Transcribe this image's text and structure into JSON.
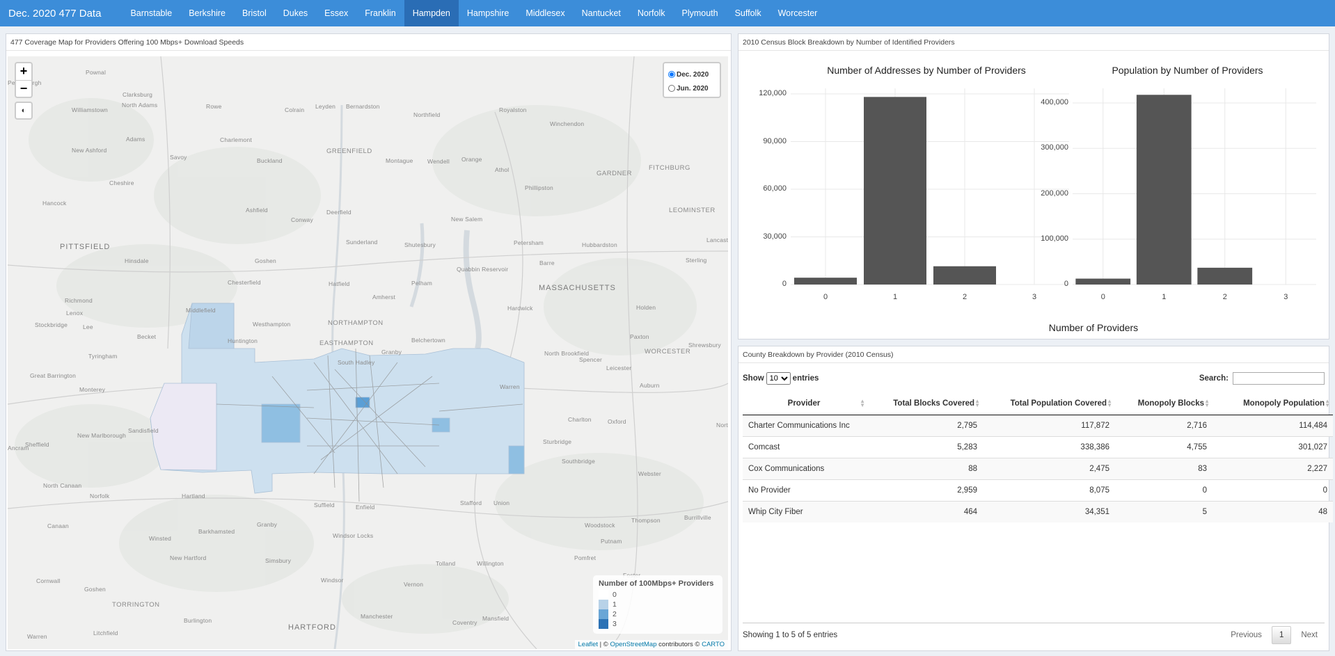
{
  "app": {
    "title": "Dec. 2020 477 Data"
  },
  "nav": {
    "items": [
      {
        "label": "Barnstable"
      },
      {
        "label": "Berkshire"
      },
      {
        "label": "Bristol"
      },
      {
        "label": "Dukes"
      },
      {
        "label": "Essex"
      },
      {
        "label": "Franklin"
      },
      {
        "label": "Hampden",
        "active": true
      },
      {
        "label": "Hampshire"
      },
      {
        "label": "Middlesex"
      },
      {
        "label": "Nantucket"
      },
      {
        "label": "Norfolk"
      },
      {
        "label": "Plymouth"
      },
      {
        "label": "Suffolk"
      },
      {
        "label": "Worcester"
      }
    ]
  },
  "map_panel": {
    "title": "477 Coverage Map for Providers Offering 100 Mbps+ Download Speeds",
    "zoom_in": "+",
    "zoom_out": "−",
    "radio_options": [
      {
        "label": "Dec. 2020",
        "checked": true
      },
      {
        "label": "Jun. 2020",
        "checked": false
      }
    ],
    "legend": {
      "title": "Number of 100Mbps+ Providers",
      "items": [
        {
          "label": "0",
          "color": "#ffffff"
        },
        {
          "label": "1",
          "color": "#b8d2e8"
        },
        {
          "label": "2",
          "color": "#6aa6d6"
        },
        {
          "label": "3",
          "color": "#2c72b5"
        }
      ]
    },
    "attribution": {
      "leaflet": "Leaflet",
      "sep1": " | © ",
      "osm": "OpenStreetMap",
      "sep2": " contributors © ",
      "carto": "CARTO"
    },
    "place_labels": [
      {
        "text": "Pownal"
      },
      {
        "text": "Petersburgh"
      },
      {
        "text": "Clarksburg"
      },
      {
        "text": "North Adams"
      },
      {
        "text": "Williamstown"
      },
      {
        "text": "Rowe"
      },
      {
        "text": "Colrain"
      },
      {
        "text": "Leyden"
      },
      {
        "text": "Bernardston"
      },
      {
        "text": "Royalston"
      },
      {
        "text": "Northfield"
      },
      {
        "text": "Winchendon"
      },
      {
        "text": "Adams"
      },
      {
        "text": "Charlemont"
      },
      {
        "text": "New Ashford"
      },
      {
        "text": "Savoy"
      },
      {
        "text": "Buckland"
      },
      {
        "text": "GREENFIELD"
      },
      {
        "text": "Montague"
      },
      {
        "text": "Wendell"
      },
      {
        "text": "Orange"
      },
      {
        "text": "Athol"
      },
      {
        "text": "GARDNER"
      },
      {
        "text": "FITCHBURG"
      },
      {
        "text": "Cheshire"
      },
      {
        "text": "Phillipston"
      },
      {
        "text": "Hancock"
      },
      {
        "text": "Ashfield"
      },
      {
        "text": "Deerfield"
      },
      {
        "text": "Conway"
      },
      {
        "text": "New Salem"
      },
      {
        "text": "LEOMINSTER"
      },
      {
        "text": "PITTSFIELD"
      },
      {
        "text": "Sunderland"
      },
      {
        "text": "Shutesbury"
      },
      {
        "text": "Petersham"
      },
      {
        "text": "Hubbardston"
      },
      {
        "text": "Lancaster"
      },
      {
        "text": "Hinsdale"
      },
      {
        "text": "Goshen"
      },
      {
        "text": "Quabbin Reservoir"
      },
      {
        "text": "Barre"
      },
      {
        "text": "Sterling"
      },
      {
        "text": "Chesterfield"
      },
      {
        "text": "Hatfield"
      },
      {
        "text": "Pelham"
      },
      {
        "text": "MASSACHUSETTS"
      },
      {
        "text": "Richmond"
      },
      {
        "text": "Lenox"
      },
      {
        "text": "Amherst"
      },
      {
        "text": "Middlefield"
      },
      {
        "text": "Hardwick"
      },
      {
        "text": "Holden"
      },
      {
        "text": "NORTHAMPTON"
      },
      {
        "text": "Paxton"
      },
      {
        "text": "Stockbridge"
      },
      {
        "text": "Lee"
      },
      {
        "text": "Westhampton"
      },
      {
        "text": "Shrewsbury"
      },
      {
        "text": "Becket"
      },
      {
        "text": "Huntington"
      },
      {
        "text": "EASTHAMPTON"
      },
      {
        "text": "Belchertown"
      },
      {
        "text": "North Brookfield"
      },
      {
        "text": "WORCESTER"
      },
      {
        "text": "Tyringham"
      },
      {
        "text": "South Hadley"
      },
      {
        "text": "Granby"
      },
      {
        "text": "Spencer"
      },
      {
        "text": "Leicester"
      },
      {
        "text": "Great Barrington"
      },
      {
        "text": "Warren"
      },
      {
        "text": "Monterey"
      },
      {
        "text": "Auburn"
      },
      {
        "text": "Charlton"
      },
      {
        "text": "Oxford"
      },
      {
        "text": "New Marlborough"
      },
      {
        "text": "Sandisfield"
      },
      {
        "text": "Sheffield"
      },
      {
        "text": "Sturbridge"
      },
      {
        "text": "Southbridge"
      },
      {
        "text": "Webster"
      },
      {
        "text": "North Canaan"
      },
      {
        "text": "Norfolk"
      },
      {
        "text": "Hartland"
      },
      {
        "text": "Stafford"
      },
      {
        "text": "Union"
      },
      {
        "text": "Suffield"
      },
      {
        "text": "Enfield"
      },
      {
        "text": "Canaan"
      },
      {
        "text": "Granby"
      },
      {
        "text": "Woodstock"
      },
      {
        "text": "Thompson"
      },
      {
        "text": "Burrillville"
      },
      {
        "text": "Barkhamsted"
      },
      {
        "text": "Windsor Locks"
      },
      {
        "text": "Winsted"
      },
      {
        "text": "Putnam"
      },
      {
        "text": "Pomfret"
      },
      {
        "text": "New Hartford"
      },
      {
        "text": "Simsbury"
      },
      {
        "text": "Tolland"
      },
      {
        "text": "Willington"
      },
      {
        "text": "Cornwall"
      },
      {
        "text": "Goshen"
      },
      {
        "text": "Windsor"
      },
      {
        "text": "Vernon"
      },
      {
        "text": "Foster"
      },
      {
        "text": "TORRINGTON"
      },
      {
        "text": "Burlington"
      },
      {
        "text": "Manchester"
      },
      {
        "text": "Mansfield"
      },
      {
        "text": "HARTFORD"
      },
      {
        "text": "Coventry"
      },
      {
        "text": "Warren"
      },
      {
        "text": "Litchfield"
      },
      {
        "text": "North"
      },
      {
        "text": "Ancram"
      }
    ]
  },
  "charts_panel": {
    "title": "2010 Census Block Breakdown by Number of Identified Providers",
    "x_axis_title": "Number of Providers"
  },
  "chart_data": [
    {
      "type": "bar",
      "title": "Number of Addresses by Number of Providers",
      "categories": [
        "0",
        "1",
        "2",
        "3"
      ],
      "values": [
        4300,
        118100,
        11500,
        0
      ],
      "ylim": [
        0,
        120000
      ],
      "yticks": [
        0,
        30000,
        60000,
        90000,
        120000
      ],
      "ytick_labels": [
        "0",
        "30,000",
        "60,000",
        "90,000",
        "120,000"
      ],
      "xlabel": "Number of Providers",
      "ylabel": "",
      "grid": true
    },
    {
      "type": "bar",
      "title": "Population by Number of Providers",
      "categories": [
        "0",
        "1",
        "2",
        "3"
      ],
      "values": [
        13000,
        418000,
        37000,
        0
      ],
      "ylim": [
        0,
        420000
      ],
      "yticks": [
        0,
        100000,
        200000,
        300000,
        400000
      ],
      "ytick_labels": [
        "0",
        "100,000",
        "200,000",
        "300,000",
        "400,000"
      ],
      "xlabel": "Number of Providers",
      "ylabel": "",
      "grid": true
    }
  ],
  "table_panel": {
    "title": "County Breakdown by Provider (2010 Census)",
    "show_label": "Show",
    "entries_label": "entries",
    "page_length": "10",
    "search_label": "Search:",
    "search_value": "",
    "columns": [
      "Provider",
      "Total Blocks Covered",
      "Total Population Covered",
      "Monopoly Blocks",
      "Monopoly Population"
    ],
    "rows": [
      [
        "Charter Communications Inc",
        "2,795",
        "117,872",
        "2,716",
        "114,484"
      ],
      [
        "Comcast",
        "5,283",
        "338,386",
        "4,755",
        "301,027"
      ],
      [
        "Cox Communications",
        "88",
        "2,475",
        "83",
        "2,227"
      ],
      [
        "No Provider",
        "2,959",
        "8,075",
        "0",
        "0"
      ],
      [
        "Whip City Fiber",
        "464",
        "34,351",
        "5",
        "48"
      ]
    ],
    "info": "Showing 1 to 5 of 5 entries",
    "pager": {
      "previous": "Previous",
      "current": "1",
      "next": "Next"
    }
  }
}
